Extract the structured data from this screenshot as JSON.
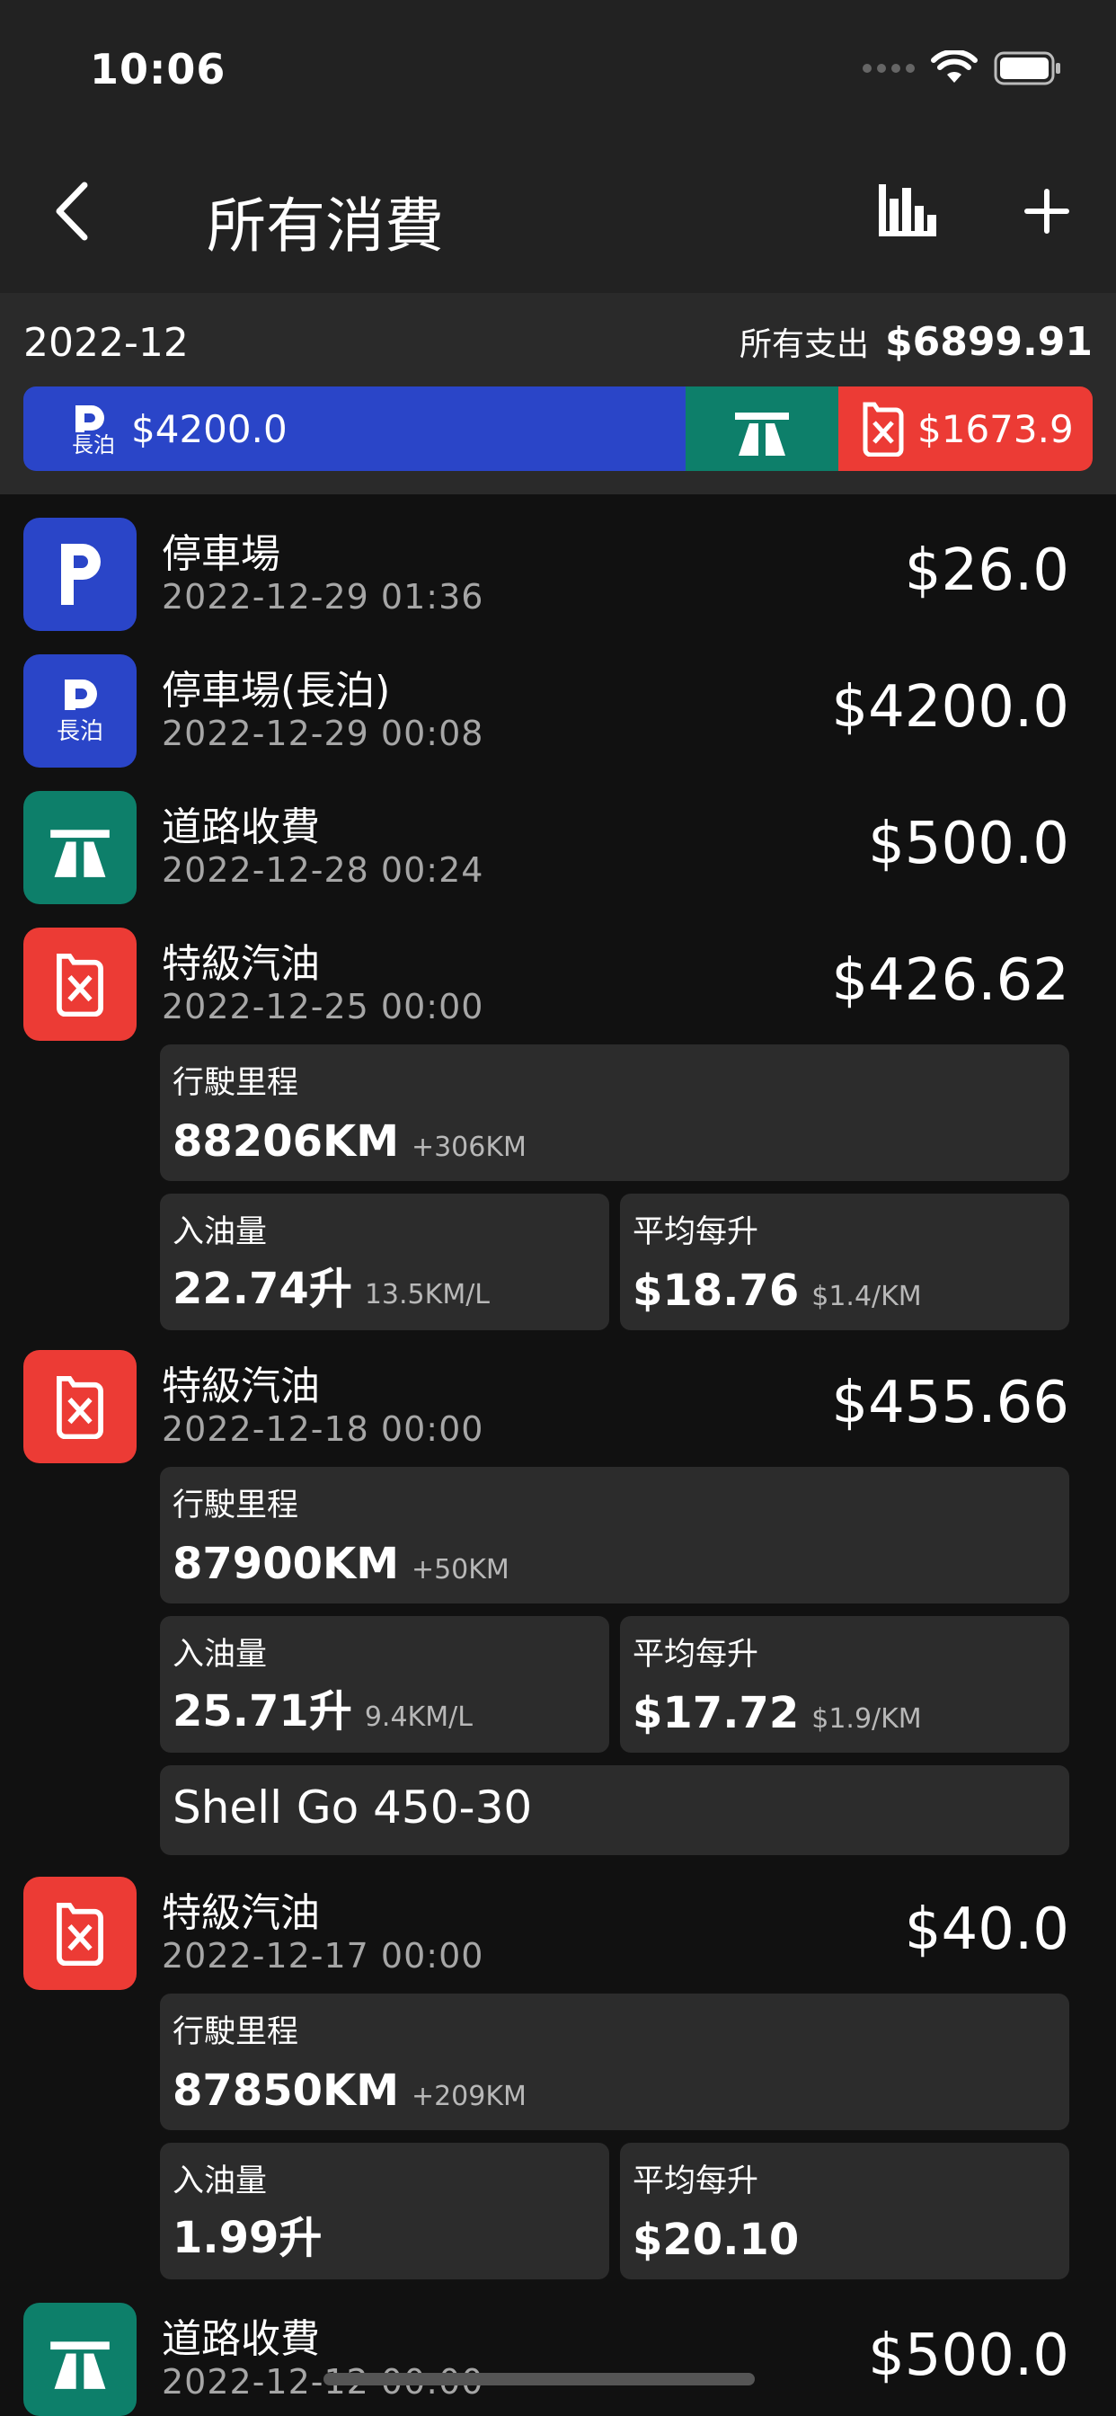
{
  "status": {
    "time": "10:06"
  },
  "nav": {
    "title": "所有消費"
  },
  "summary": {
    "month": "2022-12",
    "total_label": "所有支出",
    "total_value": "$6899.91",
    "bar": [
      {
        "type": "parking_long",
        "value": "$4200.0",
        "color": "#2a45c8",
        "badge": "長泊"
      },
      {
        "type": "toll",
        "value": "",
        "color": "#0d7f6a"
      },
      {
        "type": "fuel",
        "value": "$1673.9",
        "color": "#ec3b35"
      }
    ]
  },
  "entries": [
    {
      "category": "parking",
      "title": "停車場",
      "date": "2022-12-29 01:36",
      "amount": "$26.0"
    },
    {
      "category": "parking_long",
      "badge": "長泊",
      "title": "停車場(長泊)",
      "date": "2022-12-29 00:08",
      "amount": "$4200.0"
    },
    {
      "category": "toll",
      "title": "道路收費",
      "date": "2022-12-28 00:24",
      "amount": "$500.0"
    },
    {
      "category": "fuel",
      "title": "特級汽油",
      "date": "2022-12-25 00:00",
      "amount": "$426.62",
      "mileage_label": "行駛里程",
      "mileage": "88206KM",
      "mileage_delta": "+306KM",
      "volume_label": "入油量",
      "volume": "22.74升",
      "efficiency": "13.5KM/L",
      "price_label": "平均每升",
      "price": "$18.76",
      "cost_per_km": "$1.4/KM"
    },
    {
      "category": "fuel",
      "title": "特級汽油",
      "date": "2022-12-18 00:00",
      "amount": "$455.66",
      "mileage_label": "行駛里程",
      "mileage": "87900KM",
      "mileage_delta": "+50KM",
      "volume_label": "入油量",
      "volume": "25.71升",
      "efficiency": "9.4KM/L",
      "price_label": "平均每升",
      "price": "$17.72",
      "cost_per_km": "$1.9/KM",
      "note": "Shell Go 450-30"
    },
    {
      "category": "fuel",
      "title": "特級汽油",
      "date": "2022-12-17 00:00",
      "amount": "$40.0",
      "mileage_label": "行駛里程",
      "mileage": "87850KM",
      "mileage_delta": "+209KM",
      "volume_label": "入油量",
      "volume": "1.99升",
      "price_label": "平均每升",
      "price": "$20.10"
    },
    {
      "category": "toll",
      "title": "道路收費",
      "date": "2022-12-12 00:00",
      "amount": "$500.0"
    }
  ],
  "icons": {
    "parking": "parking-icon",
    "toll": "highway-icon",
    "fuel": "fuel-can-icon"
  }
}
